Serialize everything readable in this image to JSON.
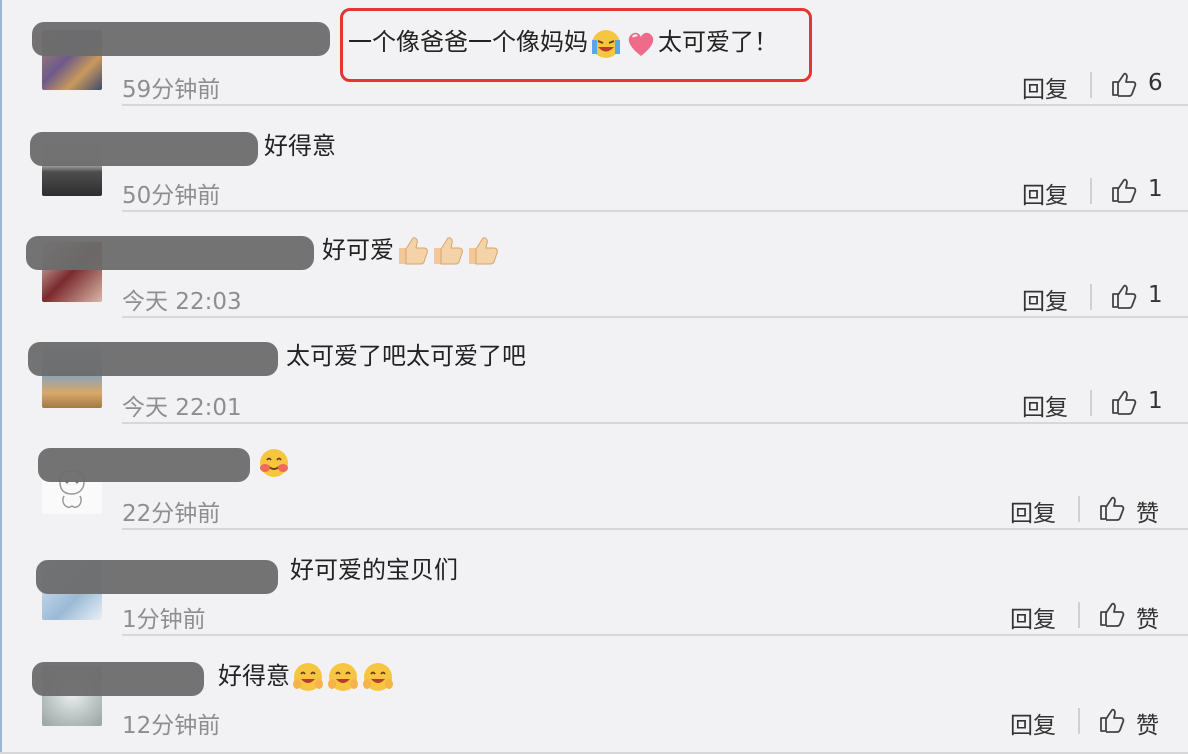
{
  "comments": [
    {
      "text": "一个像爸爸一个像妈妈",
      "text_after": "太可爱了！",
      "time": "59分钟前",
      "reply": "回复",
      "likes": "6"
    },
    {
      "text": "好得意",
      "text_after": "",
      "time": "50分钟前",
      "reply": "回复",
      "likes": "1"
    },
    {
      "text": "好可爱",
      "text_after": "",
      "time": "今天 22:03",
      "reply": "回复",
      "likes": "1"
    },
    {
      "text": "太可爱了吧太可爱了吧",
      "text_after": "",
      "time": "今天 22:01",
      "reply": "回复",
      "likes": "1"
    },
    {
      "text": "",
      "text_after": "",
      "time": "22分钟前",
      "reply": "回复",
      "likes": "赞"
    },
    {
      "text": "好可爱的宝贝们",
      "text_after": "",
      "time": "1分钟前",
      "reply": "回复",
      "likes": "赞"
    },
    {
      "text": "好得意",
      "text_after": "",
      "time": "12分钟前",
      "reply": "回复",
      "likes": "赞"
    }
  ],
  "colors": {
    "highlight": "#e7362f",
    "background": "#f2f2f4"
  }
}
